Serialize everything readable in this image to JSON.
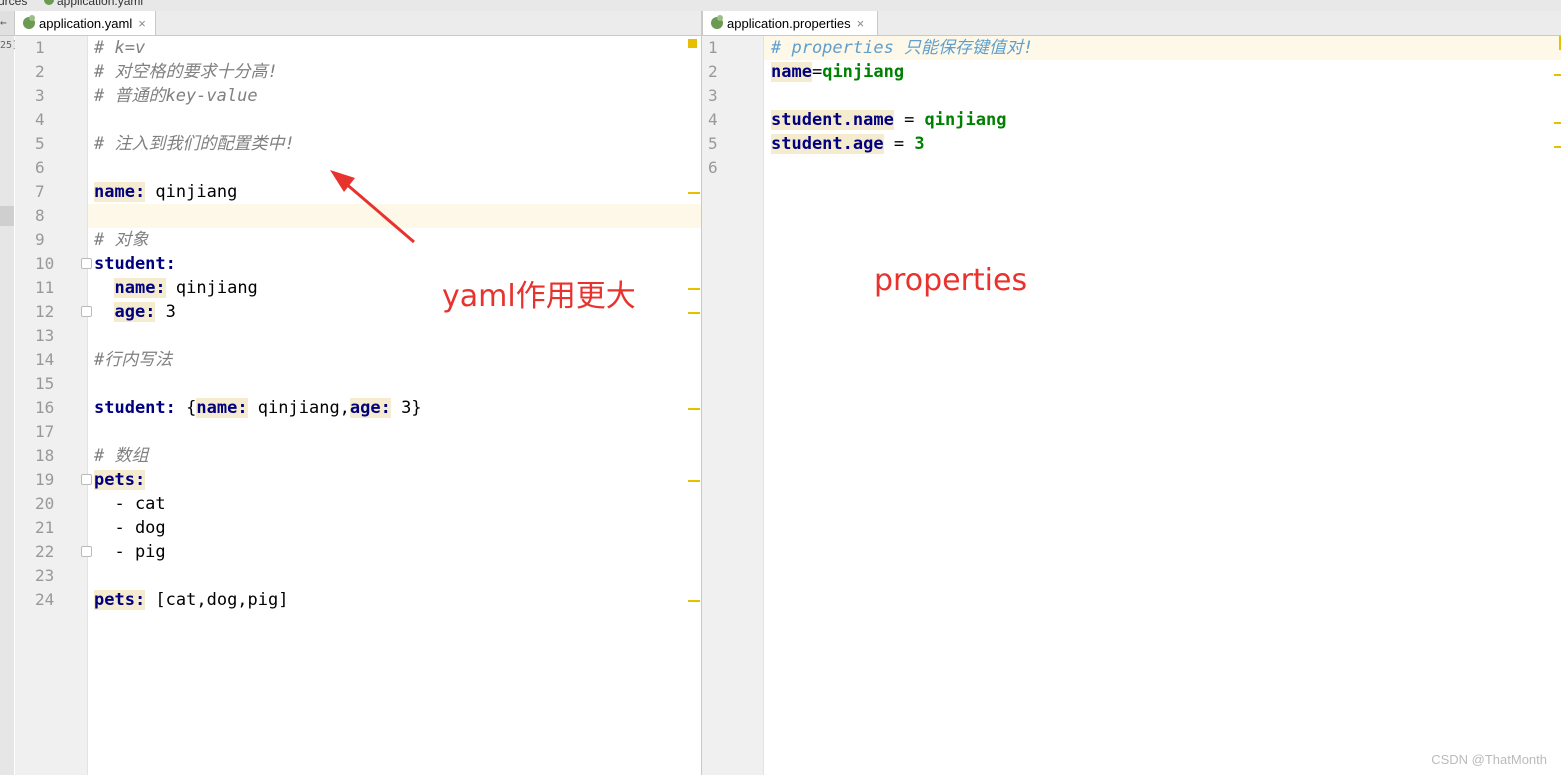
{
  "breadcrumb": {
    "left": "urces",
    "file": "application.yaml"
  },
  "tabs": {
    "left": {
      "label": "application.yaml",
      "close": "×"
    },
    "right": {
      "label": "application.properties",
      "close": "×"
    }
  },
  "left_editor": {
    "line_numbers": [
      "1",
      "2",
      "3",
      "4",
      "5",
      "6",
      "7",
      "8",
      "9",
      "10",
      "11",
      "12",
      "13",
      "14",
      "15",
      "16",
      "17",
      "18",
      "19",
      "20",
      "21",
      "22",
      "23",
      "24"
    ],
    "lines": [
      [
        {
          "t": "# k=v",
          "c": "cm"
        }
      ],
      [
        {
          "t": "# 对空格的要求十分高!",
          "c": "cm"
        }
      ],
      [
        {
          "t": "# 普通的key-value",
          "c": "cm"
        }
      ],
      [],
      [
        {
          "t": "# 注入到我们的配置类中!",
          "c": "cm"
        }
      ],
      [],
      [
        {
          "t": "name:",
          "c": "key keyhl"
        },
        {
          "t": " qinjiang",
          "c": ""
        }
      ],
      [],
      [
        {
          "t": "# 对象",
          "c": "cm"
        }
      ],
      [
        {
          "t": "student:",
          "c": "key"
        }
      ],
      [
        {
          "t": "  ",
          "c": ""
        },
        {
          "t": "name:",
          "c": "key keyhl"
        },
        {
          "t": " qinjiang",
          "c": ""
        }
      ],
      [
        {
          "t": "  ",
          "c": ""
        },
        {
          "t": "age:",
          "c": "key keyhl"
        },
        {
          "t": " 3",
          "c": ""
        }
      ],
      [],
      [
        {
          "t": "#行内写法",
          "c": "cm"
        }
      ],
      [],
      [
        {
          "t": "student:",
          "c": "key"
        },
        {
          "t": " {",
          "c": ""
        },
        {
          "t": "name:",
          "c": "key keyhl"
        },
        {
          "t": " qinjiang,",
          "c": ""
        },
        {
          "t": "age:",
          "c": "key keyhl"
        },
        {
          "t": " 3}",
          "c": ""
        }
      ],
      [],
      [
        {
          "t": "# 数组",
          "c": "cm"
        }
      ],
      [
        {
          "t": "pets:",
          "c": "key keyhl"
        }
      ],
      [
        {
          "t": "  - cat",
          "c": ""
        }
      ],
      [
        {
          "t": "  - dog",
          "c": ""
        }
      ],
      [
        {
          "t": "  - pig",
          "c": ""
        }
      ],
      [],
      [
        {
          "t": "pets:",
          "c": "key keyhl"
        },
        {
          "t": " [cat,dog,pig]",
          "c": ""
        }
      ]
    ]
  },
  "right_editor": {
    "line_numbers": [
      "1",
      "2",
      "3",
      "4",
      "5",
      "6"
    ],
    "lines": [
      [
        {
          "t": "# properties 只能保存键值对!",
          "c": "pcm"
        }
      ],
      [
        {
          "t": "name",
          "c": "key keyhl"
        },
        {
          "t": "=",
          "c": ""
        },
        {
          "t": "qinjiang",
          "c": "sval"
        }
      ],
      [],
      [
        {
          "t": "student.name",
          "c": "key keyhl"
        },
        {
          "t": " = ",
          "c": ""
        },
        {
          "t": "qinjiang",
          "c": "sval"
        }
      ],
      [
        {
          "t": "student.age",
          "c": "key keyhl"
        },
        {
          "t": " = ",
          "c": ""
        },
        {
          "t": "3",
          "c": "sval"
        }
      ],
      []
    ]
  },
  "annotations": {
    "yaml": "yaml作用更大",
    "properties": "properties"
  },
  "watermark": "CSDN @ThatMonth",
  "colors": {
    "annotation_red": "#e8322d",
    "gutter": "#f0f0f0",
    "current_line": "#fdf8e8",
    "marker": "#e6c000"
  }
}
